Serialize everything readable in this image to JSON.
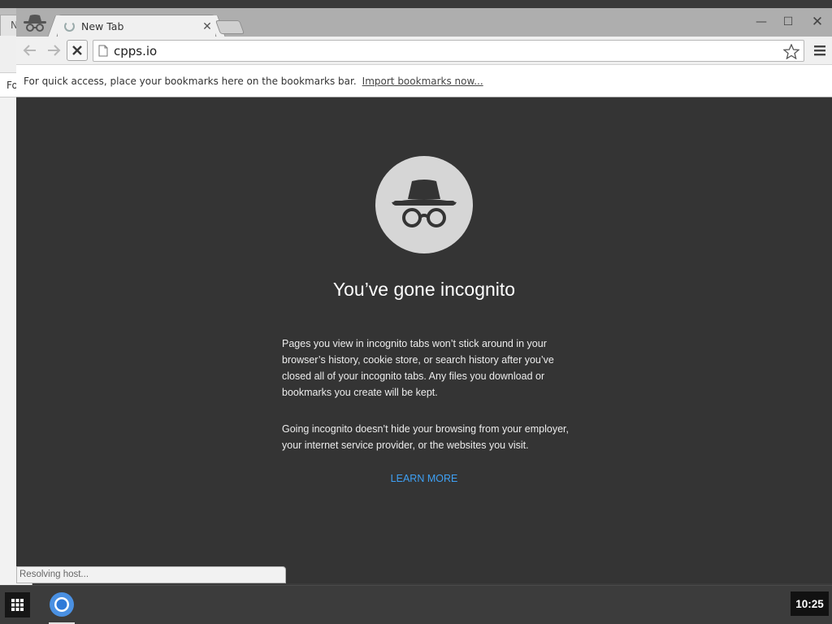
{
  "background_window": {
    "tab_fragment": "N",
    "bookmarks_fragment": "Fo"
  },
  "tab": {
    "title": "New Tab",
    "close": "✕"
  },
  "window_controls": {
    "minimize": "—",
    "maximize": "☐",
    "close": "✕"
  },
  "toolbar": {
    "url": "cpps.io"
  },
  "bookmarks_bar": {
    "message": "For quick access, place your bookmarks here on the bookmarks bar.",
    "import_link": "Import bookmarks now..."
  },
  "incognito_page": {
    "headline": "You’ve gone incognito",
    "paragraph_1": "Pages you view in incognito tabs won’t stick around in your browser’s history, cookie store, or search history after you’ve closed all of your incognito tabs. Any files you download or bookmarks you create will be kept.",
    "paragraph_2": "Going incognito doesn’t hide your browsing from your employer, your internet service provider, or the websites you visit.",
    "learn_more": "LEARN MORE"
  },
  "status_bar": {
    "text": "Resolving host..."
  },
  "shelf": {
    "clock": "10:25"
  },
  "colors": {
    "page_background": "#343434",
    "learn_more_link": "#3ea0f4",
    "incognito_circle": "#d6d6d6"
  }
}
